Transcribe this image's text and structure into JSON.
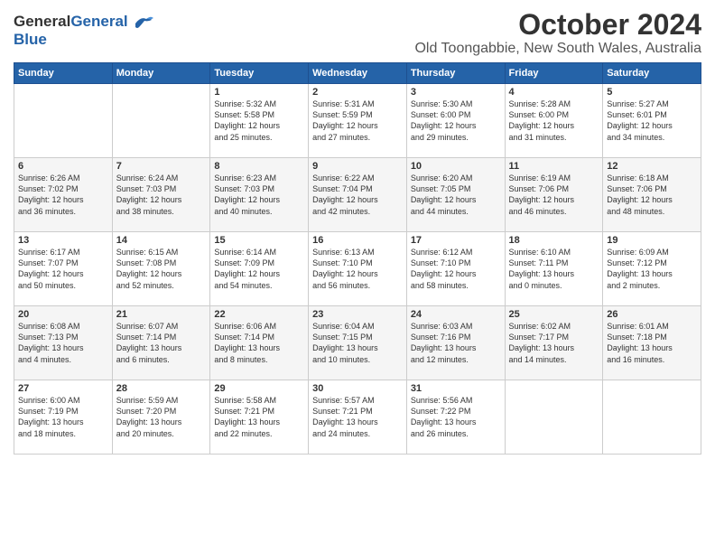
{
  "logo": {
    "line1": "General",
    "line2": "Blue"
  },
  "title": "October 2024",
  "subtitle": "Old Toongabbie, New South Wales, Australia",
  "days_header": [
    "Sunday",
    "Monday",
    "Tuesday",
    "Wednesday",
    "Thursday",
    "Friday",
    "Saturday"
  ],
  "weeks": [
    [
      {
        "day": "",
        "info": ""
      },
      {
        "day": "",
        "info": ""
      },
      {
        "day": "1",
        "info": "Sunrise: 5:32 AM\nSunset: 5:58 PM\nDaylight: 12 hours\nand 25 minutes."
      },
      {
        "day": "2",
        "info": "Sunrise: 5:31 AM\nSunset: 5:59 PM\nDaylight: 12 hours\nand 27 minutes."
      },
      {
        "day": "3",
        "info": "Sunrise: 5:30 AM\nSunset: 6:00 PM\nDaylight: 12 hours\nand 29 minutes."
      },
      {
        "day": "4",
        "info": "Sunrise: 5:28 AM\nSunset: 6:00 PM\nDaylight: 12 hours\nand 31 minutes."
      },
      {
        "day": "5",
        "info": "Sunrise: 5:27 AM\nSunset: 6:01 PM\nDaylight: 12 hours\nand 34 minutes."
      }
    ],
    [
      {
        "day": "6",
        "info": "Sunrise: 6:26 AM\nSunset: 7:02 PM\nDaylight: 12 hours\nand 36 minutes."
      },
      {
        "day": "7",
        "info": "Sunrise: 6:24 AM\nSunset: 7:03 PM\nDaylight: 12 hours\nand 38 minutes."
      },
      {
        "day": "8",
        "info": "Sunrise: 6:23 AM\nSunset: 7:03 PM\nDaylight: 12 hours\nand 40 minutes."
      },
      {
        "day": "9",
        "info": "Sunrise: 6:22 AM\nSunset: 7:04 PM\nDaylight: 12 hours\nand 42 minutes."
      },
      {
        "day": "10",
        "info": "Sunrise: 6:20 AM\nSunset: 7:05 PM\nDaylight: 12 hours\nand 44 minutes."
      },
      {
        "day": "11",
        "info": "Sunrise: 6:19 AM\nSunset: 7:06 PM\nDaylight: 12 hours\nand 46 minutes."
      },
      {
        "day": "12",
        "info": "Sunrise: 6:18 AM\nSunset: 7:06 PM\nDaylight: 12 hours\nand 48 minutes."
      }
    ],
    [
      {
        "day": "13",
        "info": "Sunrise: 6:17 AM\nSunset: 7:07 PM\nDaylight: 12 hours\nand 50 minutes."
      },
      {
        "day": "14",
        "info": "Sunrise: 6:15 AM\nSunset: 7:08 PM\nDaylight: 12 hours\nand 52 minutes."
      },
      {
        "day": "15",
        "info": "Sunrise: 6:14 AM\nSunset: 7:09 PM\nDaylight: 12 hours\nand 54 minutes."
      },
      {
        "day": "16",
        "info": "Sunrise: 6:13 AM\nSunset: 7:10 PM\nDaylight: 12 hours\nand 56 minutes."
      },
      {
        "day": "17",
        "info": "Sunrise: 6:12 AM\nSunset: 7:10 PM\nDaylight: 12 hours\nand 58 minutes."
      },
      {
        "day": "18",
        "info": "Sunrise: 6:10 AM\nSunset: 7:11 PM\nDaylight: 13 hours\nand 0 minutes."
      },
      {
        "day": "19",
        "info": "Sunrise: 6:09 AM\nSunset: 7:12 PM\nDaylight: 13 hours\nand 2 minutes."
      }
    ],
    [
      {
        "day": "20",
        "info": "Sunrise: 6:08 AM\nSunset: 7:13 PM\nDaylight: 13 hours\nand 4 minutes."
      },
      {
        "day": "21",
        "info": "Sunrise: 6:07 AM\nSunset: 7:14 PM\nDaylight: 13 hours\nand 6 minutes."
      },
      {
        "day": "22",
        "info": "Sunrise: 6:06 AM\nSunset: 7:14 PM\nDaylight: 13 hours\nand 8 minutes."
      },
      {
        "day": "23",
        "info": "Sunrise: 6:04 AM\nSunset: 7:15 PM\nDaylight: 13 hours\nand 10 minutes."
      },
      {
        "day": "24",
        "info": "Sunrise: 6:03 AM\nSunset: 7:16 PM\nDaylight: 13 hours\nand 12 minutes."
      },
      {
        "day": "25",
        "info": "Sunrise: 6:02 AM\nSunset: 7:17 PM\nDaylight: 13 hours\nand 14 minutes."
      },
      {
        "day": "26",
        "info": "Sunrise: 6:01 AM\nSunset: 7:18 PM\nDaylight: 13 hours\nand 16 minutes."
      }
    ],
    [
      {
        "day": "27",
        "info": "Sunrise: 6:00 AM\nSunset: 7:19 PM\nDaylight: 13 hours\nand 18 minutes."
      },
      {
        "day": "28",
        "info": "Sunrise: 5:59 AM\nSunset: 7:20 PM\nDaylight: 13 hours\nand 20 minutes."
      },
      {
        "day": "29",
        "info": "Sunrise: 5:58 AM\nSunset: 7:21 PM\nDaylight: 13 hours\nand 22 minutes."
      },
      {
        "day": "30",
        "info": "Sunrise: 5:57 AM\nSunset: 7:21 PM\nDaylight: 13 hours\nand 24 minutes."
      },
      {
        "day": "31",
        "info": "Sunrise: 5:56 AM\nSunset: 7:22 PM\nDaylight: 13 hours\nand 26 minutes."
      },
      {
        "day": "",
        "info": ""
      },
      {
        "day": "",
        "info": ""
      }
    ]
  ]
}
